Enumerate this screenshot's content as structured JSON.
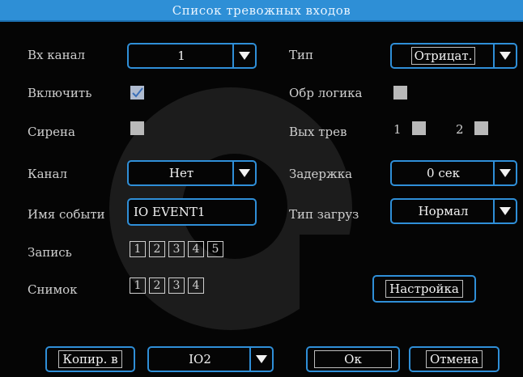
{
  "title": "Список тревожных входов",
  "fields": {
    "input_channel": {
      "label": "Вх канал",
      "value": "1"
    },
    "type": {
      "label": "Тип",
      "value": "Отрицат."
    },
    "enable": {
      "label": "Включить",
      "checked": true
    },
    "reverse_logic": {
      "label": "Обр логика",
      "checked": false
    },
    "siren": {
      "label": "Сирена",
      "checked": false
    },
    "alarm_out": {
      "label": "Вых трев",
      "out1": "1",
      "out2": "2"
    },
    "channel": {
      "label": "Канал",
      "value": "Нет"
    },
    "delay": {
      "label": "Задержка",
      "value": "0 сек"
    },
    "event_name": {
      "label": "Имя событи",
      "value": "IO EVENT1"
    },
    "load_type": {
      "label": "Тип загруз",
      "value": "Нормал"
    },
    "record": {
      "label": "Запись",
      "channels": [
        "1",
        "2",
        "3",
        "4",
        "5"
      ]
    },
    "snapshot": {
      "label": "Снимок",
      "channels": [
        "1",
        "2",
        "3",
        "4"
      ]
    }
  },
  "buttons": {
    "settings": "Настройка",
    "copy_to": "Копир. в",
    "copy_target": "IO2",
    "ok": "Ок",
    "cancel": "Отмена"
  },
  "colors": {
    "title_bar": "#2e8fd6",
    "control_border": "#2f8fd8",
    "background": "#050505"
  }
}
